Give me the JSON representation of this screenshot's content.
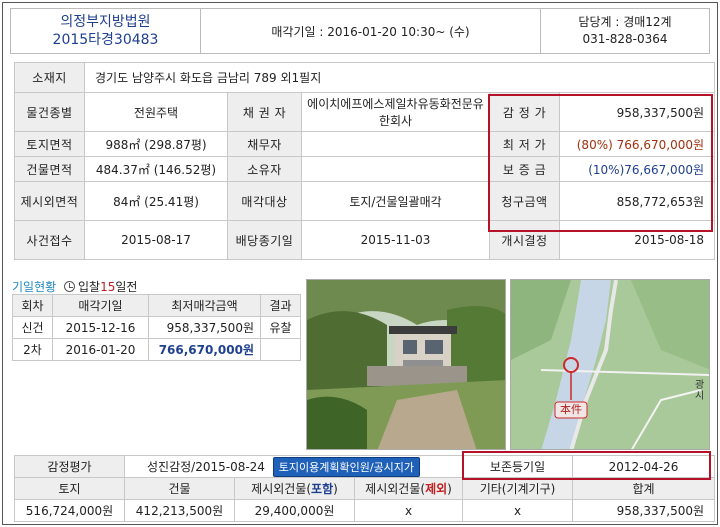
{
  "header": {
    "court": "의정부지방법원",
    "case_no": "2015타경30483",
    "auction_date": "매각기일 : 2016-01-20   10:30~ (수)",
    "dept": "담당계 : 경매12계",
    "phone": "031-828-0364"
  },
  "main": {
    "address_label": "소재지",
    "address": "경기도 남양주시 화도읍 금남리 789 외1필지",
    "rows": {
      "type_label": "물건종별",
      "type": "전원주택",
      "creditor_label": "채 권 자",
      "creditor": "에이치에프에스제일차유동화전문유한회사",
      "appraisal_label": "감 정 가",
      "appraisal": "958,337,500원",
      "land_label": "토지면적",
      "land": "988㎡ (298.87평)",
      "debtor_label": "채무자",
      "debtor": "",
      "min_label": "최 저 가",
      "min_pct": "(80%)",
      "min": "766,670,000원",
      "bldg_label": "건물면적",
      "bldg": "484.37㎡ (146.52평)",
      "owner_label": "소유자",
      "owner": "",
      "deposit_label": "보 증 금",
      "deposit": "(10%)76,667,000원",
      "extra_label": "제시외면적",
      "extra": "84㎡ (25.41평)",
      "target_label": "매각대상",
      "target": "토지/건물일괄매각",
      "claim_label": "청구금액",
      "claim": "858,772,653원",
      "receipt_label": "사건접수",
      "receipt": "2015-08-17",
      "dividend_label": "배당종기일",
      "dividend": "2015-11-03",
      "start_label": "개시결정",
      "start": "2015-08-18"
    }
  },
  "history": {
    "title": "기일현황",
    "sub_prefix": "입찰",
    "sub_num": "15",
    "sub_suffix": "일전",
    "headers": [
      "회차",
      "매각기일",
      "최저매각금액",
      "결과"
    ],
    "rows": [
      {
        "round": "신건",
        "date": "2015-12-16",
        "price": "958,337,500원",
        "result": "유찰"
      },
      {
        "round": "2차",
        "date": "2016-01-20",
        "price": "766,670,000원",
        "result": ""
      }
    ]
  },
  "map": {
    "label": "本件",
    "side_text": "광\n시"
  },
  "bottom": {
    "appraisal_label": "감정평가",
    "appraisal_value": "성진감정/2015-08-24",
    "badge": "토지이용계획확인원/공시지가",
    "preserve_label": "보존등기일",
    "preserve_value": "2012-04-26",
    "headers": {
      "land": "토지",
      "bldg": "건물",
      "extra_in_prefix": "제시외건물(",
      "extra_in_word": "포함",
      "extra_ex_prefix": "제시외건물(",
      "extra_ex_word": "제외",
      "close": ")",
      "etc": "기타(기계기구)",
      "total": "합계"
    },
    "values": {
      "land": "516,724,000원",
      "bldg": "412,213,500원",
      "extra_in": "29,400,000원",
      "extra_ex": "x",
      "etc": "x",
      "total": "958,337,500원"
    }
  },
  "colors": {
    "accent_red": "#b5122a",
    "link_blue": "#1f3f8f",
    "badge_blue": "#1f60b8"
  }
}
